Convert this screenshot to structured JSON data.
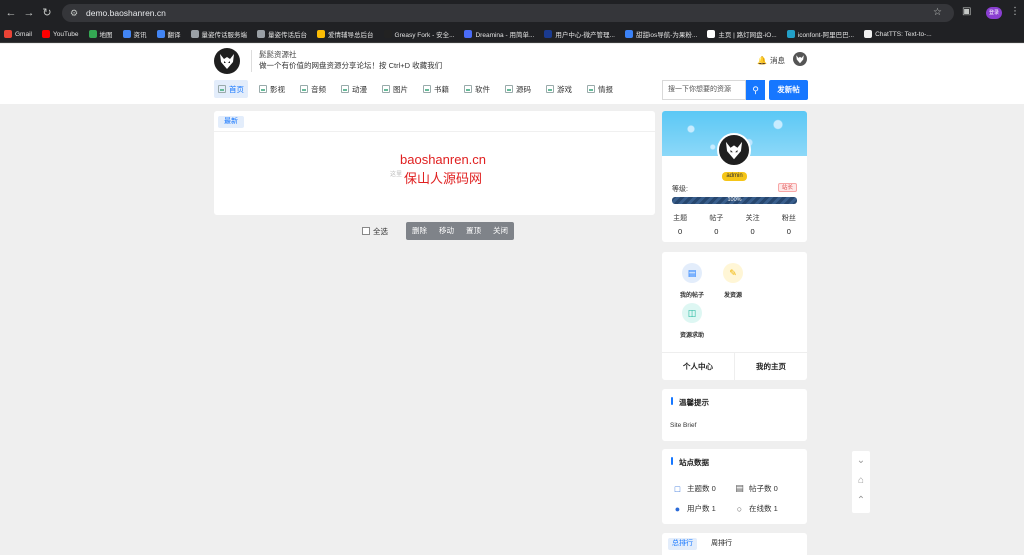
{
  "browser": {
    "url": "demo.baoshanren.cn",
    "profile_label": "登录",
    "bookmarks": [
      {
        "label": "Gmail",
        "color": "#ea4335"
      },
      {
        "label": "YouTube",
        "color": "#ff0000"
      },
      {
        "label": "地图",
        "color": "#34a853"
      },
      {
        "label": "资讯",
        "color": "#4285f4"
      },
      {
        "label": "翻译",
        "color": "#4285f4"
      },
      {
        "label": "量姿传话服务端",
        "color": "#9aa0a6"
      },
      {
        "label": "量姿传话后台",
        "color": "#9aa0a6"
      },
      {
        "label": "爱情辅导总后台",
        "color": "#fbbc04"
      },
      {
        "label": "Greasy Fork - 安全...",
        "color": "#222222"
      },
      {
        "label": "Dreamina - 用简单...",
        "color": "#4a6cf7"
      },
      {
        "label": "用户中心-微产管理...",
        "color": "#1a3a8f"
      },
      {
        "label": "甜甜ios导航-为果粉...",
        "color": "#3b82f6"
      },
      {
        "label": "主页 | 路灯网盘-iO...",
        "color": "#ffffff"
      },
      {
        "label": "iconfont-阿里巴巴...",
        "color": "#22a0c8"
      },
      {
        "label": "ChatTTS: Text-to-...",
        "color": "#f0f0f0"
      }
    ]
  },
  "header": {
    "brand_name": "髭髭资源社",
    "slogan": "做一个有价值的网盘资源分享论坛！按 Ctrl+D 收藏我们",
    "message_label": "消息"
  },
  "nav": {
    "items": [
      {
        "label": "首页",
        "active": true
      },
      {
        "label": "影视",
        "active": false
      },
      {
        "label": "音频",
        "active": false
      },
      {
        "label": "动漫",
        "active": false
      },
      {
        "label": "图片",
        "active": false
      },
      {
        "label": "书籍",
        "active": false
      },
      {
        "label": "软件",
        "active": false
      },
      {
        "label": "源码",
        "active": false
      },
      {
        "label": "游戏",
        "active": false
      },
      {
        "label": "情报",
        "active": false
      }
    ],
    "search_placeholder": "搜一下你想要的资源",
    "post_button": "发新帖"
  },
  "main": {
    "tab_label": "最新",
    "empty_text": "这里",
    "watermark_domain": "baoshanren.cn",
    "watermark_name": "保山人源码网"
  },
  "batch": {
    "select_all": "全选",
    "buttons": [
      "删除",
      "移动",
      "置顶",
      "关闭"
    ]
  },
  "profile": {
    "username": "admin",
    "level_label": "等级:",
    "role_badge": "站长",
    "progress_text": "100%",
    "progress_value": 1.0,
    "stats": [
      {
        "label": "主题",
        "value": "0"
      },
      {
        "label": "帖子",
        "value": "0"
      },
      {
        "label": "关注",
        "value": "0"
      },
      {
        "label": "粉丝",
        "value": "0"
      }
    ]
  },
  "quick": {
    "my_posts": "我的帖子",
    "post_resource": "发资源",
    "resource_request": "资源求助",
    "personal_center": "个人中心",
    "my_home": "我的主页"
  },
  "tips": {
    "title": "温馨提示",
    "text": "Site Brief"
  },
  "site_data": {
    "title": "站点数据",
    "topics_label": "主题数",
    "topics": "0",
    "posts_label": "帖子数",
    "posts": "0",
    "users_label": "用户数",
    "users": "1",
    "online_label": "在线数",
    "online": "1"
  },
  "ranking": {
    "total_tab": "总排行",
    "week_tab": "周排行"
  },
  "colors": {
    "accent": "#1677ff",
    "badge_yellow": "#f5c518",
    "owner_red": "#e04848"
  }
}
